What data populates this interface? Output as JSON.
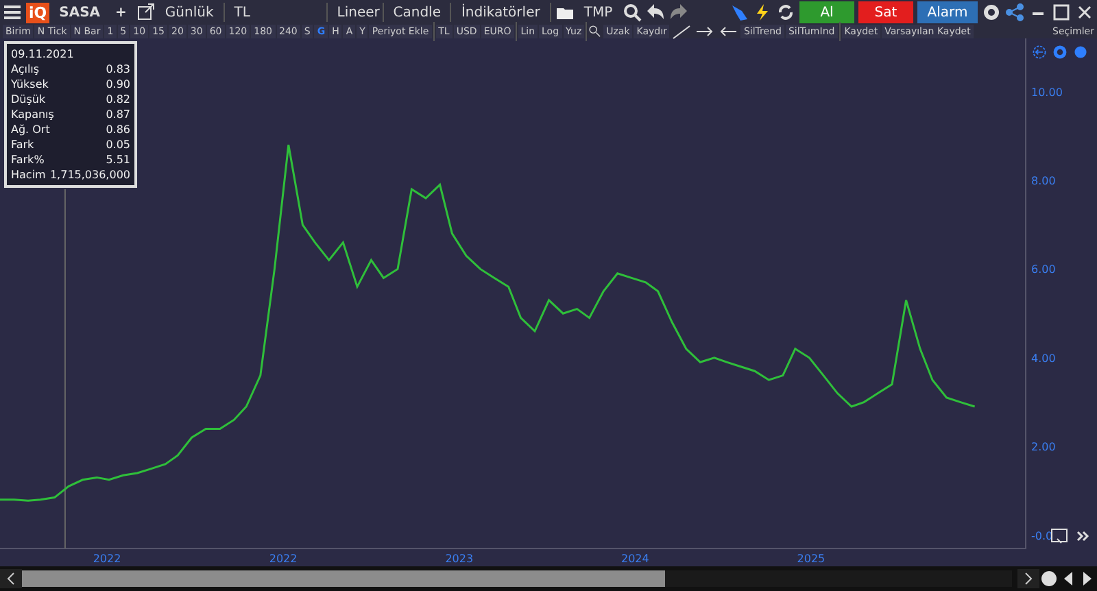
{
  "toolbar": {
    "logo": "iQ",
    "symbol": "SASA",
    "add": "+",
    "period": "Günlük",
    "currency": "TL",
    "scale": "Lineer",
    "chart_type": "Candle",
    "indicators": "İndikatörler",
    "template": "TMP"
  },
  "trade_buttons": [
    {
      "label": "Al",
      "kind": "buy"
    },
    {
      "label": "Sat",
      "kind": "sell"
    },
    {
      "label": "Alarm",
      "kind": "alarm"
    }
  ],
  "period_bar": [
    {
      "label": "Birim",
      "selected": false
    },
    {
      "label": "N Tick",
      "selected": false
    },
    {
      "label": "N Bar",
      "selected": false
    },
    {
      "label": "1",
      "selected": false
    },
    {
      "label": "5",
      "selected": false
    },
    {
      "label": "10",
      "selected": false
    },
    {
      "label": "15",
      "selected": false
    },
    {
      "label": "20",
      "selected": false
    },
    {
      "label": "30",
      "selected": false
    },
    {
      "label": "60",
      "selected": false
    },
    {
      "label": "120",
      "selected": false
    },
    {
      "label": "180",
      "selected": false
    },
    {
      "label": "240",
      "selected": false
    },
    {
      "label": "S",
      "selected": false
    },
    {
      "label": "G",
      "selected": true
    },
    {
      "label": "H",
      "selected": false
    },
    {
      "label": "A",
      "selected": false
    },
    {
      "label": "Y",
      "selected": false
    },
    {
      "label": "Periyot Ekle",
      "selected": false
    }
  ],
  "currency_bar": [
    "TL",
    "USD",
    "EURO"
  ],
  "scale_bar": [
    "Lin",
    "Log",
    "Yuz"
  ],
  "tools_bar": [
    "Uzak",
    "Kaydır",
    "SilTrend",
    "SilTumInd"
  ],
  "save_bar": [
    "Kaydet",
    "Varsayılan Kaydet"
  ],
  "selections_label": "Seçimler",
  "info_box": {
    "date": "09.11.2021",
    "rows": [
      {
        "label": "Açılış",
        "value": "0.83"
      },
      {
        "label": "Yüksek",
        "value": "0.90"
      },
      {
        "label": "Düşük",
        "value": "0.82"
      },
      {
        "label": "Kapanış",
        "value": "0.87"
      },
      {
        "label": "Ağ. Ort",
        "value": "0.86"
      },
      {
        "label": "Fark",
        "value": "0.05"
      },
      {
        "label": "Fark%",
        "value": "5.51"
      },
      {
        "label": "Hacim",
        "value": "1,715,036,000"
      }
    ]
  },
  "time_axis_first_label": "2022",
  "chart_data": {
    "type": "line",
    "x": [
      2020.39,
      2020.47,
      2020.55,
      2020.62,
      2020.7,
      2020.78,
      2020.86,
      2020.94,
      2021.01,
      2021.09,
      2021.17,
      2021.25,
      2021.33,
      2021.4,
      2021.48,
      2021.56,
      2021.64,
      2021.72,
      2021.79,
      2021.87,
      2021.95,
      2022.03,
      2022.11,
      2022.18,
      2022.26,
      2022.34,
      2022.42,
      2022.5,
      2022.57,
      2022.65,
      2022.73,
      2022.81,
      2022.89,
      2022.96,
      2023.04,
      2023.12,
      2023.2,
      2023.28,
      2023.35,
      2023.43,
      2023.51,
      2023.59,
      2023.67,
      2023.74,
      2023.82,
      2023.9,
      2023.98,
      2024.06,
      2024.13,
      2024.21,
      2024.29,
      2024.37,
      2024.45,
      2024.52,
      2024.6,
      2024.68,
      2024.76,
      2024.84,
      2024.91,
      2024.99,
      2025.07,
      2025.15,
      2025.23,
      2025.3,
      2025.38,
      2025.46,
      2025.54,
      2025.62,
      2025.69,
      2025.77,
      2025.85,
      2025.93
    ],
    "series": [
      {
        "color": "#2fbf3a",
        "values": [
          0.8,
          0.8,
          0.78,
          0.8,
          0.85,
          1.1,
          1.25,
          1.3,
          1.25,
          1.35,
          1.4,
          1.5,
          1.6,
          1.8,
          2.2,
          2.4,
          2.4,
          2.6,
          2.9,
          3.6,
          6.0,
          8.8,
          7.0,
          6.6,
          6.2,
          6.6,
          5.6,
          6.2,
          5.8,
          6.0,
          7.8,
          7.6,
          7.9,
          6.8,
          6.3,
          6.0,
          5.8,
          5.6,
          4.9,
          4.6,
          5.3,
          5.0,
          5.1,
          4.9,
          5.5,
          5.9,
          5.8,
          5.7,
          5.5,
          4.8,
          4.2,
          3.9,
          4.0,
          3.9,
          3.8,
          3.7,
          3.5,
          3.6,
          4.2,
          4.0,
          3.6,
          3.2,
          2.9,
          3.0,
          3.2,
          3.4,
          5.3,
          4.2,
          3.5,
          3.1,
          3.0,
          2.9
        ]
      }
    ],
    "ref_lines": [
      {
        "axis": "x",
        "value": 2020.76
      }
    ],
    "xlim": [
      2020.39,
      2026.22
    ],
    "ylim": [
      -0.3,
      11.2
    ],
    "xticks": [
      {
        "value": 2022,
        "label": "2022"
      },
      {
        "value": 2023,
        "label": "2023"
      },
      {
        "value": 2024,
        "label": "2024"
      },
      {
        "value": 2025,
        "label": "2025"
      }
    ],
    "yticks": [
      {
        "value": 0,
        "label": "-0.0"
      },
      {
        "value": 2,
        "label": "2.00"
      },
      {
        "value": 4,
        "label": "4.00"
      },
      {
        "value": 6,
        "label": "6.00"
      },
      {
        "value": 8,
        "label": "8.00"
      },
      {
        "value": 10,
        "label": "10.00"
      }
    ]
  }
}
